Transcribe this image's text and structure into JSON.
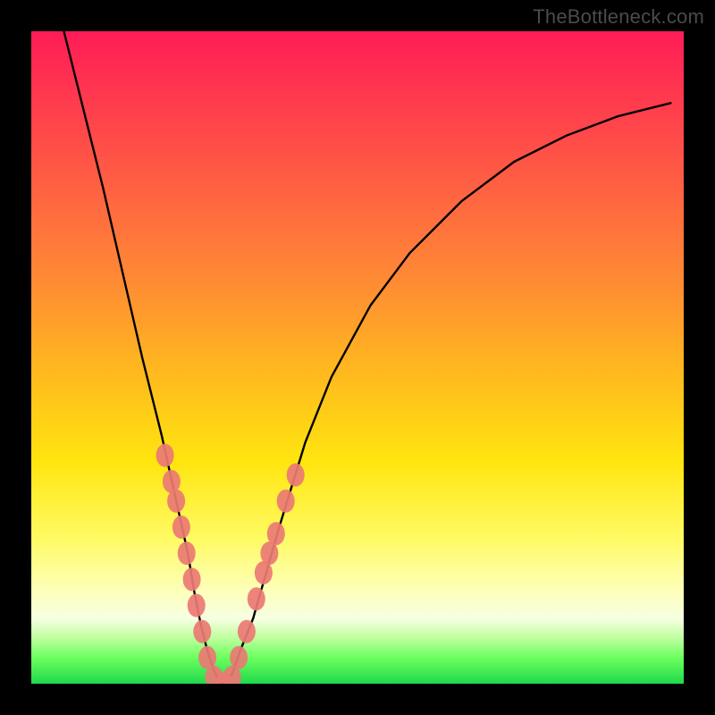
{
  "watermark": "TheBottleneck.com",
  "chart_data": {
    "type": "line",
    "title": "",
    "xlabel": "",
    "ylabel": "",
    "xlim": [
      0,
      100
    ],
    "ylim": [
      0,
      100
    ],
    "grid": false,
    "legend": false,
    "series": [
      {
        "name": "bottleneck-curve",
        "color": "#000000",
        "x": [
          5,
          8,
          11,
          14,
          17,
          20,
          22,
          24,
          25,
          26,
          27,
          28,
          29,
          30,
          31,
          32,
          34,
          36,
          38,
          42,
          46,
          52,
          58,
          66,
          74,
          82,
          90,
          98
        ],
        "y": [
          100,
          88,
          76,
          63,
          50,
          38,
          29,
          20,
          14,
          9,
          5,
          2,
          0,
          0,
          2,
          5,
          10,
          17,
          24,
          37,
          47,
          58,
          66,
          74,
          80,
          84,
          87,
          89
        ]
      }
    ],
    "markers": {
      "name": "highlighted-points",
      "color": "#ea7a74",
      "points": [
        {
          "x": 20.5,
          "y": 35
        },
        {
          "x": 21.5,
          "y": 31
        },
        {
          "x": 22.2,
          "y": 28
        },
        {
          "x": 23.0,
          "y": 24
        },
        {
          "x": 23.8,
          "y": 20
        },
        {
          "x": 24.6,
          "y": 16
        },
        {
          "x": 25.3,
          "y": 12
        },
        {
          "x": 26.2,
          "y": 8
        },
        {
          "x": 27.0,
          "y": 4
        },
        {
          "x": 28.0,
          "y": 1
        },
        {
          "x": 29.5,
          "y": 0
        },
        {
          "x": 30.8,
          "y": 1
        },
        {
          "x": 31.8,
          "y": 4
        },
        {
          "x": 33.0,
          "y": 8
        },
        {
          "x": 34.5,
          "y": 13
        },
        {
          "x": 35.6,
          "y": 17
        },
        {
          "x": 36.5,
          "y": 20
        },
        {
          "x": 37.5,
          "y": 23
        },
        {
          "x": 39.0,
          "y": 28
        },
        {
          "x": 40.5,
          "y": 32
        }
      ]
    }
  }
}
